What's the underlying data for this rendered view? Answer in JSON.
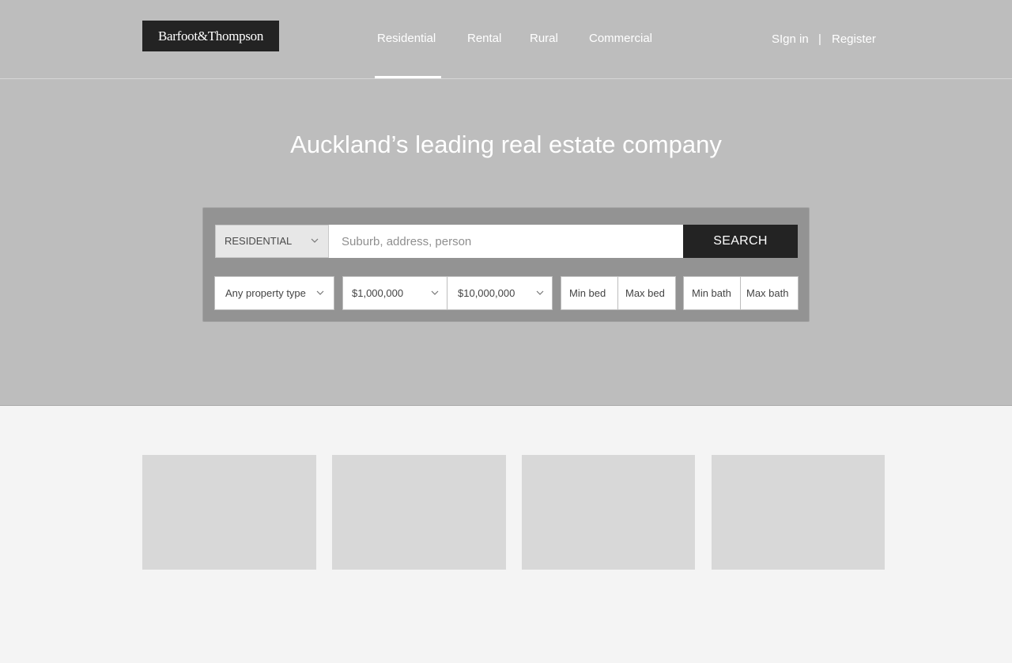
{
  "header": {
    "logo_text": "Barfoot&Thompson",
    "nav": [
      {
        "label": "Residential",
        "active": true
      },
      {
        "label": "Rental",
        "active": false
      },
      {
        "label": "Rural",
        "active": false
      },
      {
        "label": "Commercial",
        "active": false
      }
    ],
    "auth": {
      "sign_in": "SIgn in",
      "separator": "|",
      "register": "Register"
    }
  },
  "hero": {
    "headline": "Auckland’s leading real estate company"
  },
  "search": {
    "listing_type": "RESIDENTIAL",
    "placeholder": "Suburb, address, person",
    "button_label": "SEARCH",
    "filters": {
      "property_type": "Any property type",
      "price_min": "$1,000,000",
      "price_max": "$10,000,000",
      "min_bed": "Min bed",
      "max_bed": "Max bed",
      "min_bath": "Min bath",
      "max_bath": "Max bath"
    }
  },
  "colors": {
    "hero_bg": "#bdbdbd",
    "panel_bg": "#939393",
    "accent_dark": "#232323",
    "page_bg": "#f4f4f4",
    "card_placeholder": "#d8d8d8"
  },
  "icons": {
    "dropdown": "chevron-down-icon"
  },
  "cards": [
    {
      "placeholder": true
    },
    {
      "placeholder": true
    },
    {
      "placeholder": true
    },
    {
      "placeholder": true
    }
  ]
}
